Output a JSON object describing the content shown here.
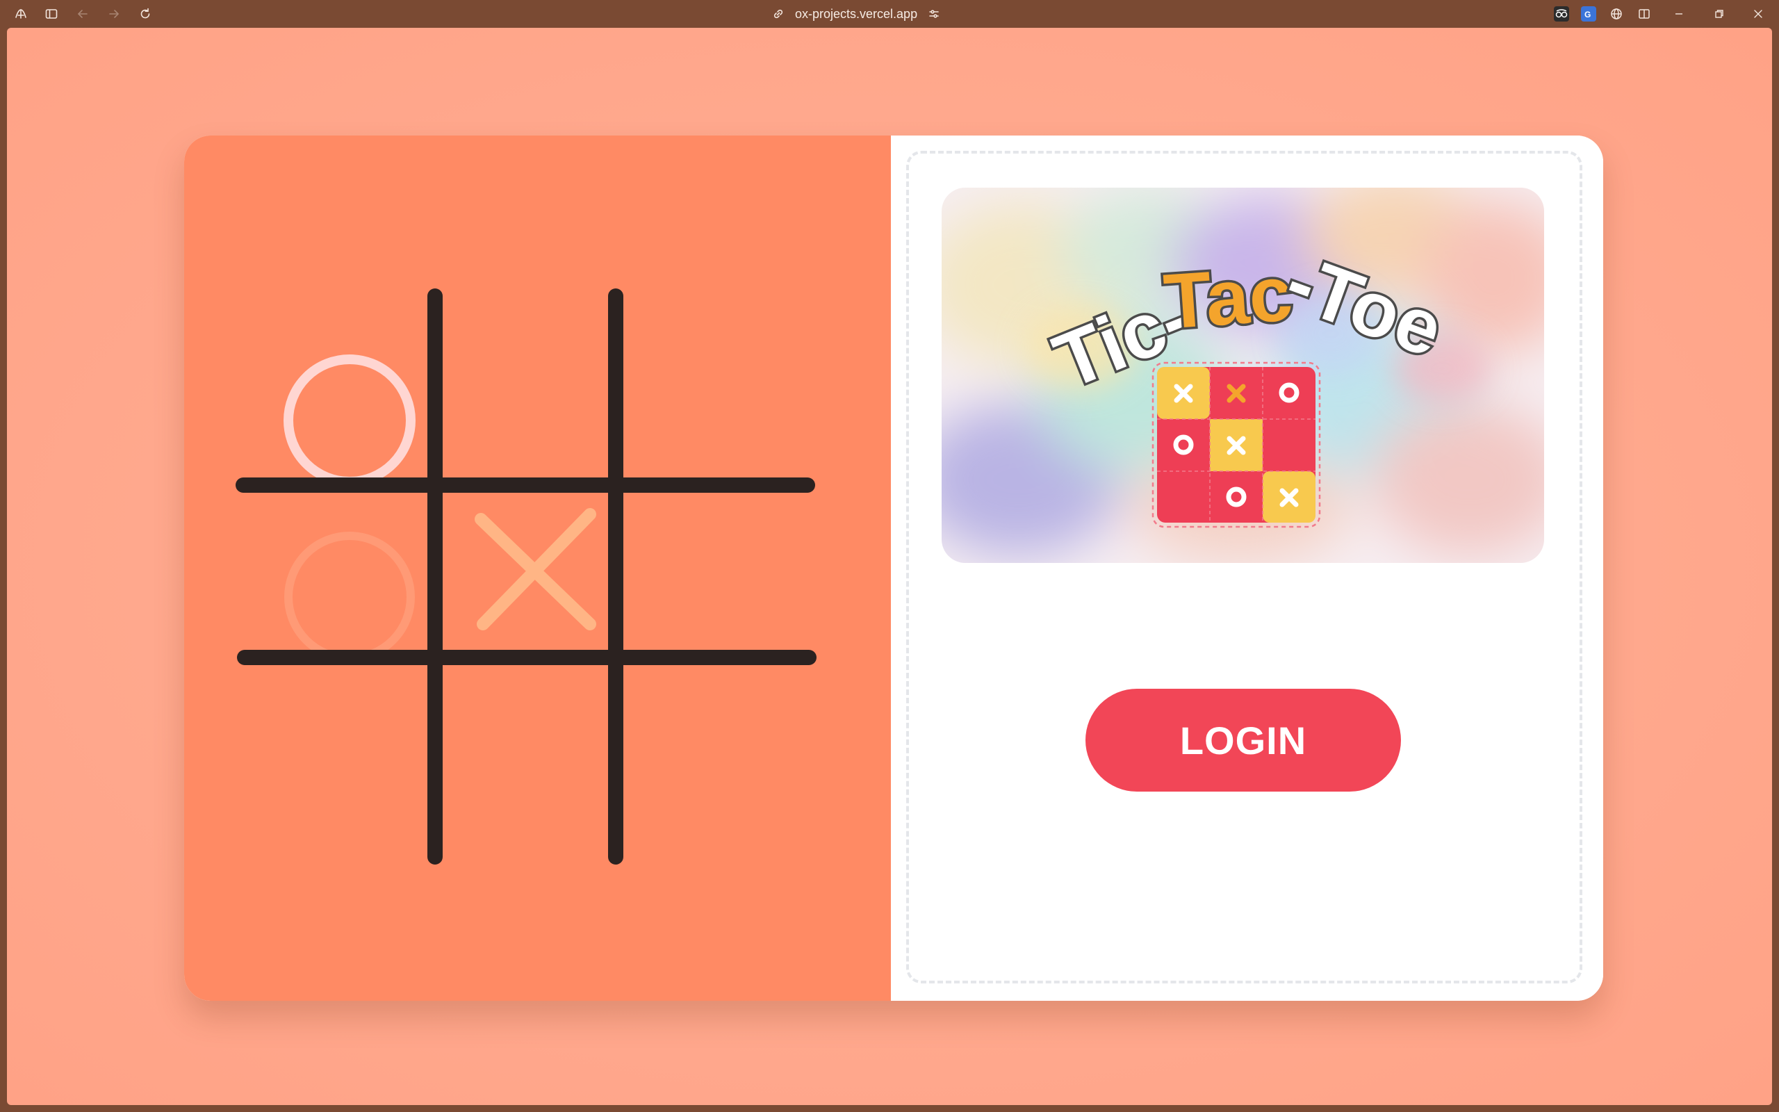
{
  "browser": {
    "url": "ox-projects.vercel.app",
    "icons": {
      "app": "app-logo-icon",
      "sidebar": "sidebar-toggle-icon",
      "back": "back-arrow-icon",
      "forward": "forward-arrow-icon",
      "reload": "reload-icon",
      "link": "link-icon",
      "settings": "site-settings-icon",
      "extension_1": "glasses-extension-icon",
      "extension_2": "translate-extension-icon",
      "globe": "globe-icon",
      "split": "split-view-icon",
      "minimize": "minimize-icon",
      "restore": "restore-icon",
      "close": "close-icon"
    }
  },
  "page": {
    "background_color": "#ffa88d",
    "left_panel": {
      "background_color": "#ff8a64",
      "grid_line_color": "#2b2220",
      "marks": [
        {
          "cell": "top-left",
          "symbol": "O",
          "color": "#ffd6d2"
        },
        {
          "cell": "middle-left",
          "symbol": "O",
          "color": "#ff9a76"
        },
        {
          "cell": "center",
          "symbol": "X",
          "color": "#ffb585"
        }
      ]
    },
    "banner": {
      "title_parts": [
        "Tic-",
        "Tac",
        "-Toe"
      ],
      "board": [
        [
          "X",
          "X",
          "O"
        ],
        [
          "O",
          "X",
          ""
        ],
        [
          "",
          "O",
          "X"
        ]
      ],
      "colors": {
        "yellow": "#f8c94e",
        "red": "#ee3e55",
        "orange_x": "#f4a42c"
      }
    },
    "login_button": {
      "label": "LOGIN",
      "color": "#f24657"
    }
  }
}
